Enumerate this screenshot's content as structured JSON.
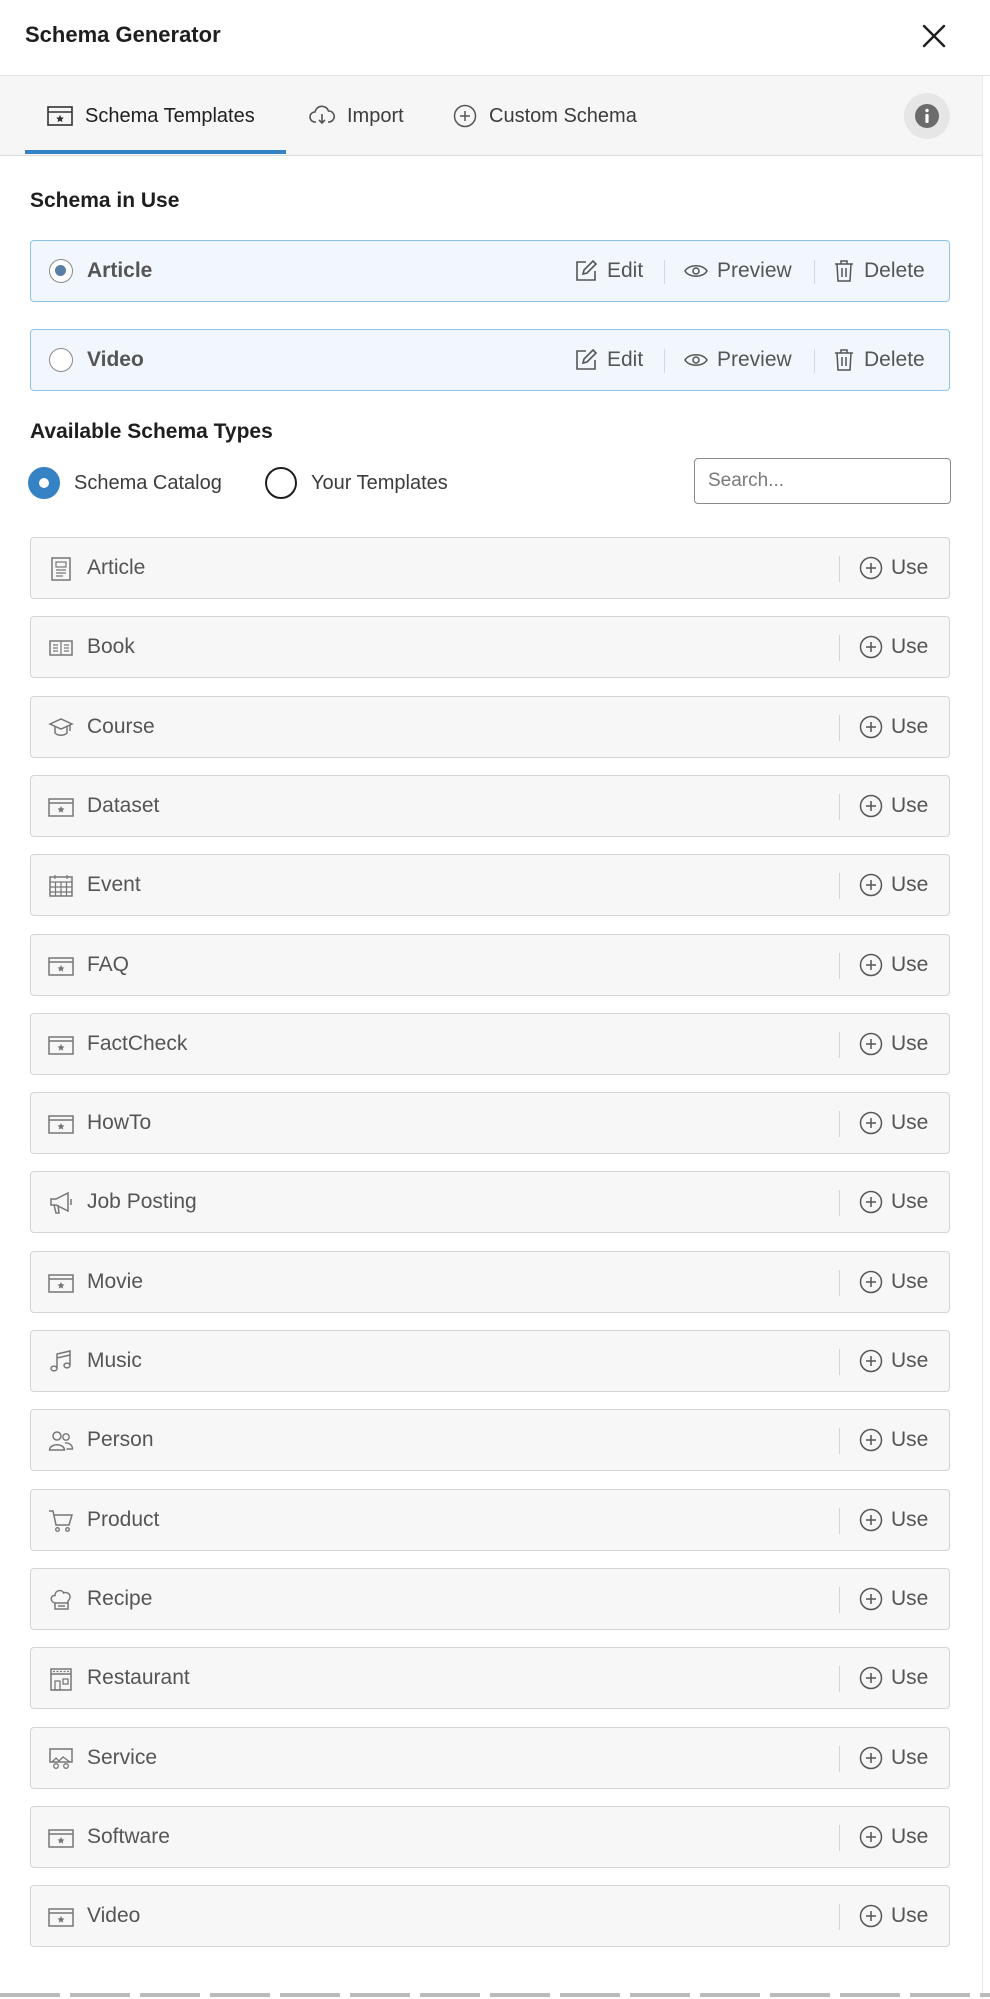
{
  "header": {
    "title": "Schema Generator"
  },
  "tabs": [
    {
      "label": "Schema Templates",
      "icon": "template-icon",
      "active": true
    },
    {
      "label": "Import",
      "icon": "cloud-download-icon",
      "active": false
    },
    {
      "label": "Custom Schema",
      "icon": "plus-circle-icon",
      "active": false
    }
  ],
  "schema_in_use": {
    "title": "Schema in Use",
    "items": [
      {
        "name": "Article",
        "selected": true
      },
      {
        "name": "Video",
        "selected": false
      }
    ],
    "actions": {
      "edit": "Edit",
      "preview": "Preview",
      "delete": "Delete"
    }
  },
  "available": {
    "title": "Available Schema Types",
    "filters": [
      {
        "label": "Schema Catalog",
        "selected": true
      },
      {
        "label": "Your Templates",
        "selected": false
      }
    ],
    "search_placeholder": "Search...",
    "use_label": "Use",
    "types": [
      {
        "name": "Article",
        "icon": "document-icon"
      },
      {
        "name": "Book",
        "icon": "book-icon"
      },
      {
        "name": "Course",
        "icon": "graduation-cap-icon"
      },
      {
        "name": "Dataset",
        "icon": "template-icon"
      },
      {
        "name": "Event",
        "icon": "calendar-icon"
      },
      {
        "name": "FAQ",
        "icon": "template-icon"
      },
      {
        "name": "FactCheck",
        "icon": "template-icon"
      },
      {
        "name": "HowTo",
        "icon": "template-icon"
      },
      {
        "name": "Job Posting",
        "icon": "megaphone-icon"
      },
      {
        "name": "Movie",
        "icon": "template-icon"
      },
      {
        "name": "Music",
        "icon": "music-note-icon"
      },
      {
        "name": "Person",
        "icon": "people-icon"
      },
      {
        "name": "Product",
        "icon": "cart-icon"
      },
      {
        "name": "Recipe",
        "icon": "chef-hat-icon"
      },
      {
        "name": "Restaurant",
        "icon": "store-icon"
      },
      {
        "name": "Service",
        "icon": "service-desk-icon"
      },
      {
        "name": "Software",
        "icon": "template-icon"
      },
      {
        "name": "Video",
        "icon": "template-icon"
      }
    ]
  },
  "colors": {
    "accent": "#3582c4",
    "in_use_border": "#8ec2e6",
    "in_use_bg": "#f1f7fc"
  }
}
